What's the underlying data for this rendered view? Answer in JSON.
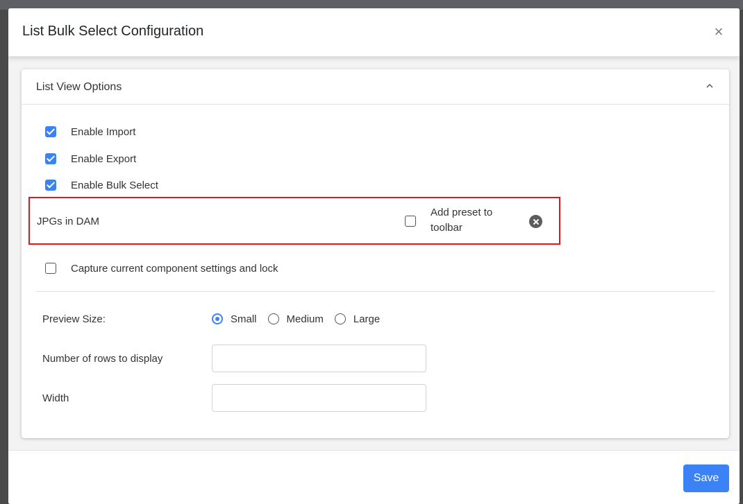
{
  "modal": {
    "title": "List Bulk Select Configuration",
    "close_symbol": "×"
  },
  "card": {
    "title": "List View Options",
    "expanded": true
  },
  "options": [
    {
      "label": "Enable Import",
      "checked": true
    },
    {
      "label": "Enable Export",
      "checked": true
    },
    {
      "label": "Enable Bulk Select",
      "checked": true
    }
  ],
  "preset": {
    "name": "JPGs in DAM",
    "add_to_toolbar_label": "Add preset to toolbar",
    "add_to_toolbar_checked": false,
    "highlight_color": "#e8131b"
  },
  "capture": {
    "label": "Capture current component settings and lock",
    "checked": false
  },
  "preview_size": {
    "label": "Preview Size:",
    "options": [
      "Small",
      "Medium",
      "Large"
    ],
    "selected": "Small"
  },
  "rows_field": {
    "label": "Number of rows to display",
    "value": ""
  },
  "width_field": {
    "label": "Width",
    "value": ""
  },
  "footer": {
    "save_label": "Save"
  },
  "colors": {
    "accent": "#3b82f6"
  }
}
